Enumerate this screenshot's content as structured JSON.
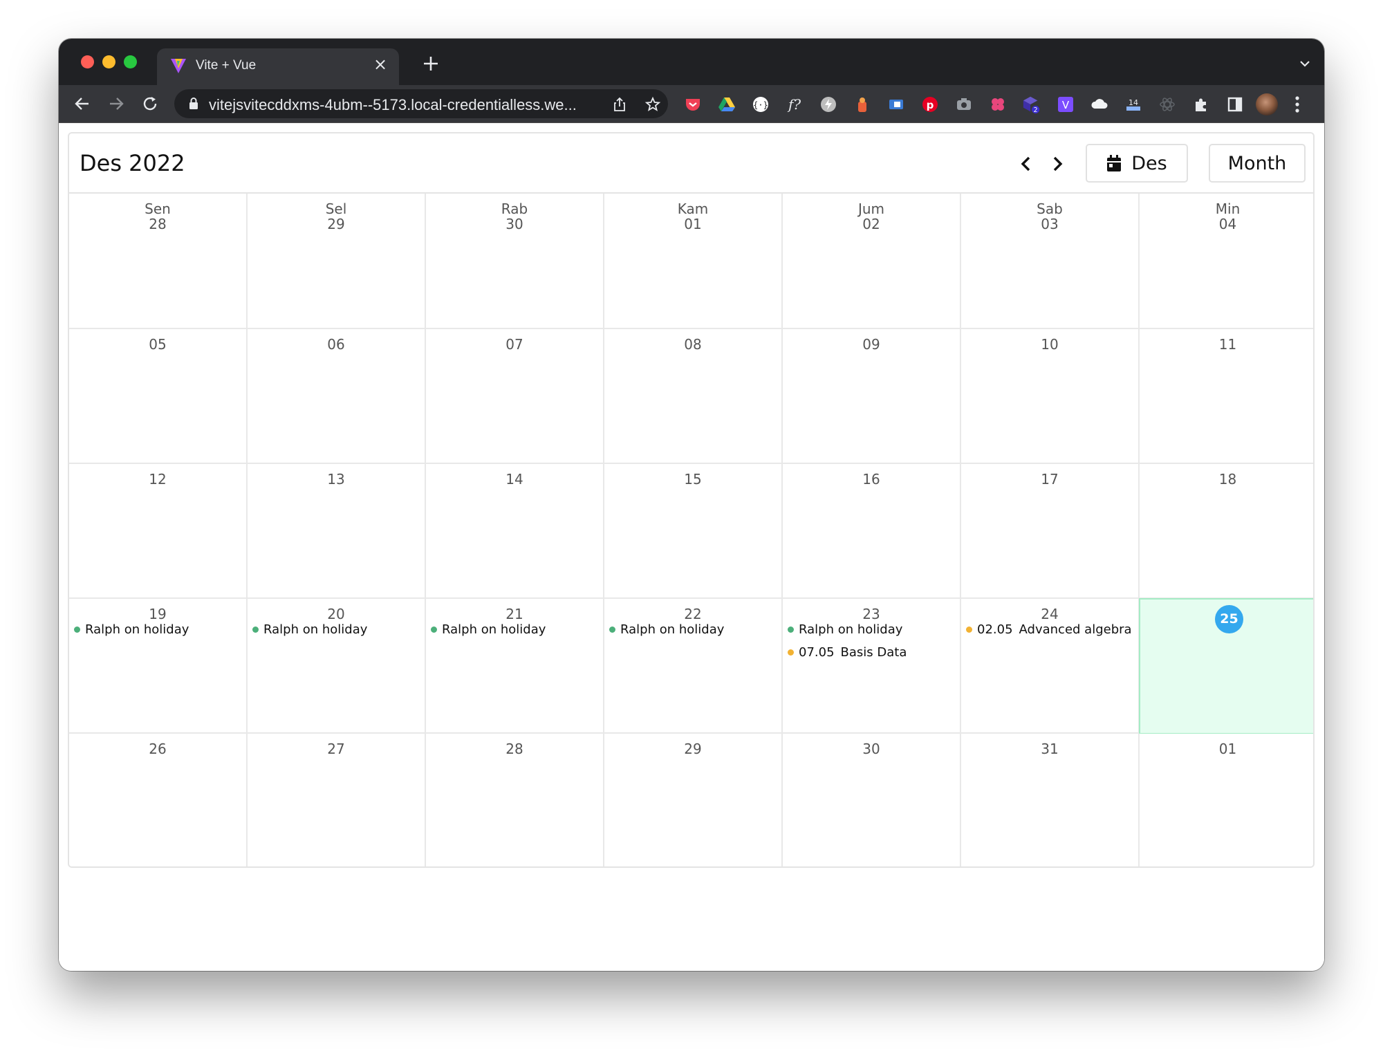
{
  "browser": {
    "tab_title": "Vite + Vue",
    "url": "vitejsvitecddxms-4ubm--5173.local-credentialless.we...",
    "extension_badges": {
      "badge_2": "2",
      "badge_14": "14"
    }
  },
  "calendar": {
    "title": "Des 2022",
    "today_button_label": "Des",
    "view_button_label": "Month",
    "colors": {
      "today_bg": "#e5fdf0",
      "today_badge": "#34a8ee",
      "holiday_dot": "#4caf7a",
      "class_dot": "#f2b233"
    },
    "weekday_names": [
      "Sen",
      "Sel",
      "Rab",
      "Kam",
      "Jum",
      "Sab",
      "Min"
    ],
    "weeks": [
      [
        "28",
        "29",
        "30",
        "01",
        "02",
        "03",
        "04"
      ],
      [
        "05",
        "06",
        "07",
        "08",
        "09",
        "10",
        "11"
      ],
      [
        "12",
        "13",
        "14",
        "15",
        "16",
        "17",
        "18"
      ],
      [
        "19",
        "20",
        "21",
        "22",
        "23",
        "24",
        "25"
      ],
      [
        "26",
        "27",
        "28",
        "29",
        "30",
        "31",
        "01"
      ]
    ],
    "today": "25",
    "events": {
      "mon19": {
        "title": "Ralph on holiday"
      },
      "tue20": {
        "title": "Ralph on holiday"
      },
      "wed21": {
        "title": "Ralph on holiday"
      },
      "thu22": {
        "title": "Ralph on holiday"
      },
      "fri23": {
        "title": "Ralph on holiday"
      },
      "fri23_class": {
        "time": "07.05",
        "title": "Basis Data"
      },
      "sat24_class": {
        "time": "02.05",
        "title": "Advanced algebra"
      }
    }
  }
}
